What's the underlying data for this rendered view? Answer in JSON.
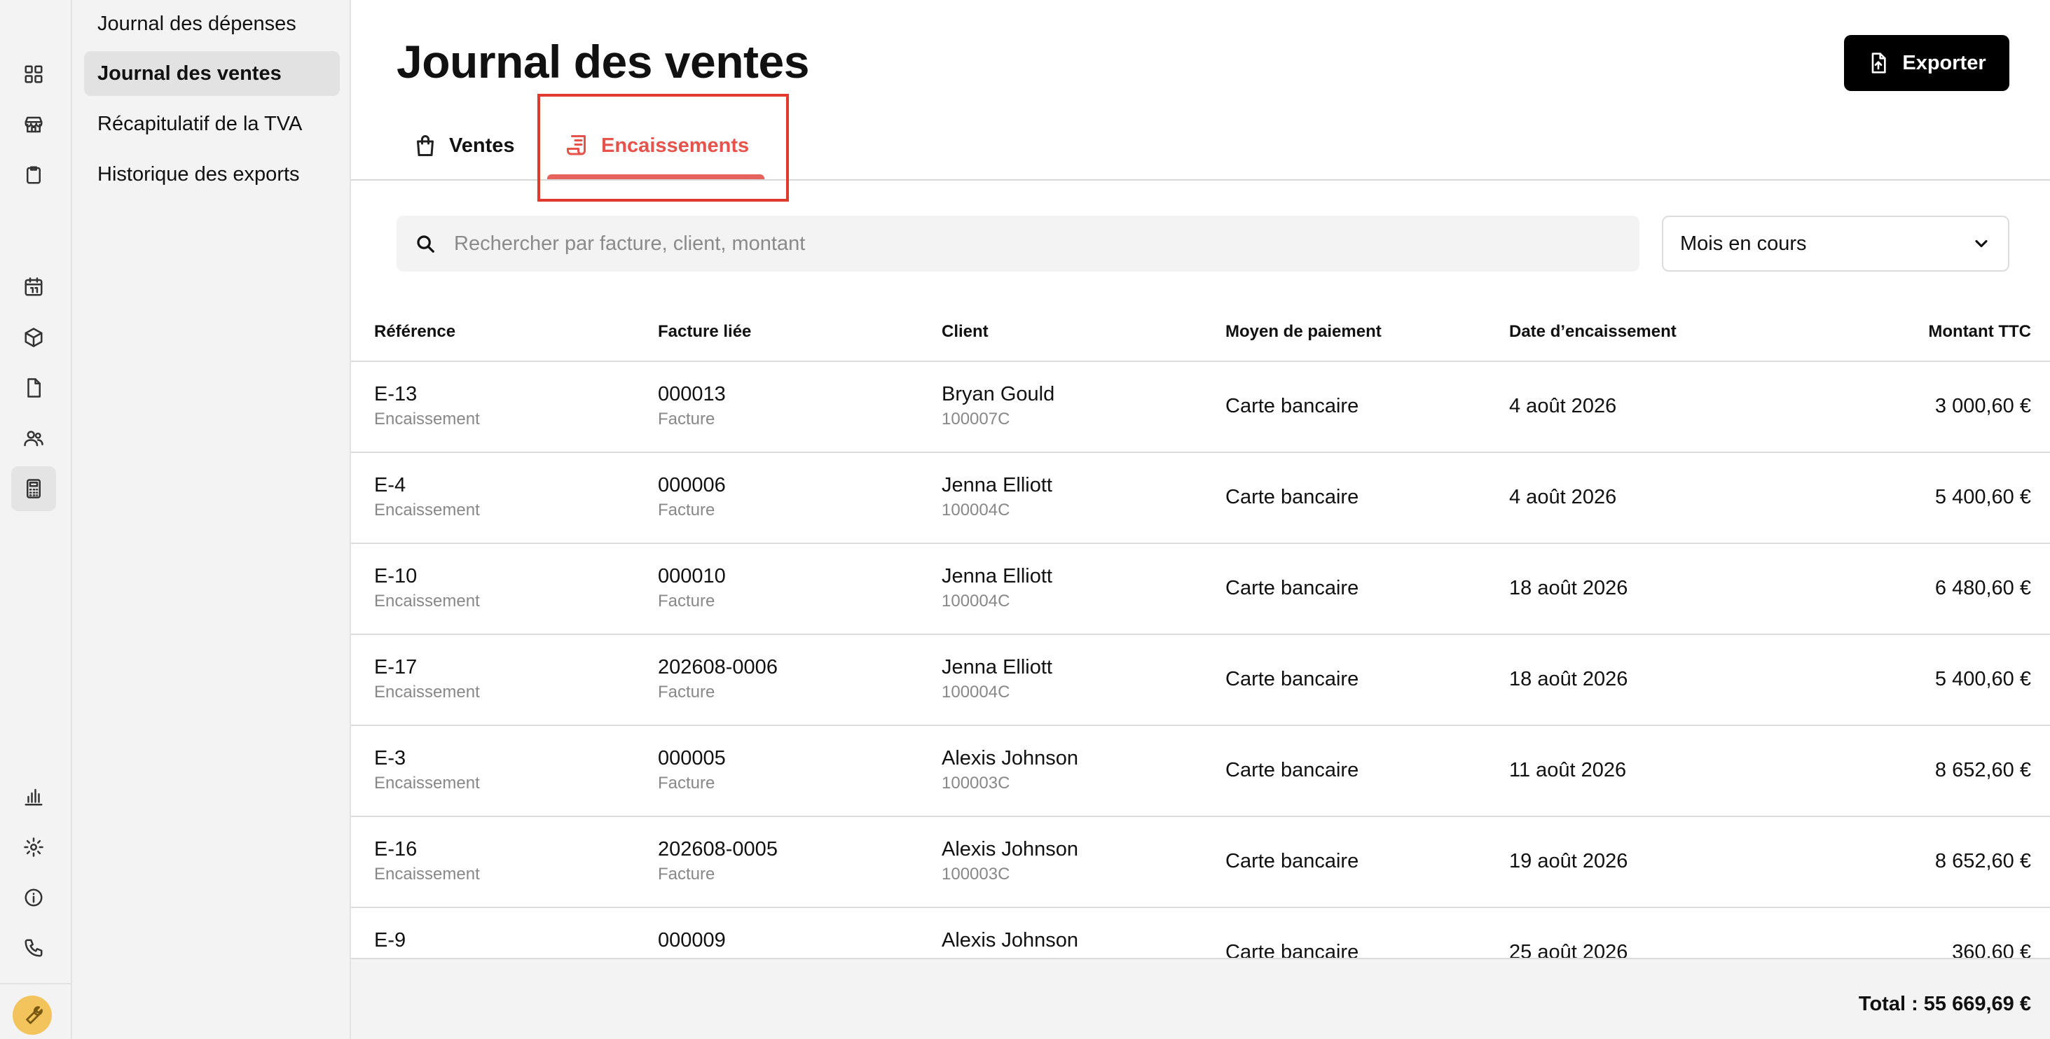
{
  "subnav": {
    "items": [
      {
        "label": "Journal des dépenses"
      },
      {
        "label": "Journal des ventes"
      },
      {
        "label": "Récapitulatif de la TVA"
      },
      {
        "label": "Historique des exports"
      }
    ]
  },
  "header": {
    "title": "Journal des ventes",
    "export_label": "Exporter"
  },
  "tabs": [
    {
      "label": "Ventes",
      "active": false
    },
    {
      "label": "Encaissements",
      "active": true
    }
  ],
  "search": {
    "placeholder": "Rechercher par facture, client, montant",
    "value": ""
  },
  "period": {
    "selected": "Mois en cours"
  },
  "table": {
    "columns": [
      "Référence",
      "Facture liée",
      "Client",
      "Moyen de paiement",
      "Date d’encaissement",
      "Montant TTC"
    ],
    "rows": [
      {
        "ref": "E-13",
        "ref_sub": "Encaissement",
        "invoice": "000013",
        "invoice_sub": "Facture",
        "client": "Bryan Gould",
        "client_sub": "100007C",
        "method": "Carte bancaire",
        "date": "4 août 2026",
        "amount": "3 000,60 €"
      },
      {
        "ref": "E-4",
        "ref_sub": "Encaissement",
        "invoice": "000006",
        "invoice_sub": "Facture",
        "client": "Jenna Elliott",
        "client_sub": "100004C",
        "method": "Carte bancaire",
        "date": "4 août 2026",
        "amount": "5 400,60 €"
      },
      {
        "ref": "E-10",
        "ref_sub": "Encaissement",
        "invoice": "000010",
        "invoice_sub": "Facture",
        "client": "Jenna Elliott",
        "client_sub": "100004C",
        "method": "Carte bancaire",
        "date": "18 août 2026",
        "amount": "6 480,60 €"
      },
      {
        "ref": "E-17",
        "ref_sub": "Encaissement",
        "invoice": "202608-0006",
        "invoice_sub": "Facture",
        "client": "Jenna Elliott",
        "client_sub": "100004C",
        "method": "Carte bancaire",
        "date": "18 août 2026",
        "amount": "5 400,60 €"
      },
      {
        "ref": "E-3",
        "ref_sub": "Encaissement",
        "invoice": "000005",
        "invoice_sub": "Facture",
        "client": "Alexis Johnson",
        "client_sub": "100003C",
        "method": "Carte bancaire",
        "date": "11 août 2026",
        "amount": "8 652,60 €"
      },
      {
        "ref": "E-16",
        "ref_sub": "Encaissement",
        "invoice": "202608-0005",
        "invoice_sub": "Facture",
        "client": "Alexis Johnson",
        "client_sub": "100003C",
        "method": "Carte bancaire",
        "date": "19 août 2026",
        "amount": "8 652,60 €"
      },
      {
        "ref": "E-9",
        "ref_sub": "",
        "invoice": "000009",
        "invoice_sub": "",
        "client": "Alexis Johnson",
        "client_sub": "",
        "method": "Carte bancaire",
        "date": "25 août 2026",
        "amount": "360,60 €"
      }
    ]
  },
  "footer": {
    "total": "Total : 55 669,69 €"
  },
  "rail_icons": [
    "dashboard-icon",
    "store-icon",
    "clipboard-icon",
    "calendar-icon",
    "box-icon",
    "document-icon",
    "users-icon",
    "calculator-icon",
    "bar-chart-icon",
    "gear-icon",
    "info-icon",
    "phone-icon",
    "wrench-icon"
  ],
  "colors": {
    "accent": "#e5534b",
    "highlight_box": "#e0392e",
    "export_bg": "#000000",
    "wrench_bg": "#f4c45c"
  }
}
